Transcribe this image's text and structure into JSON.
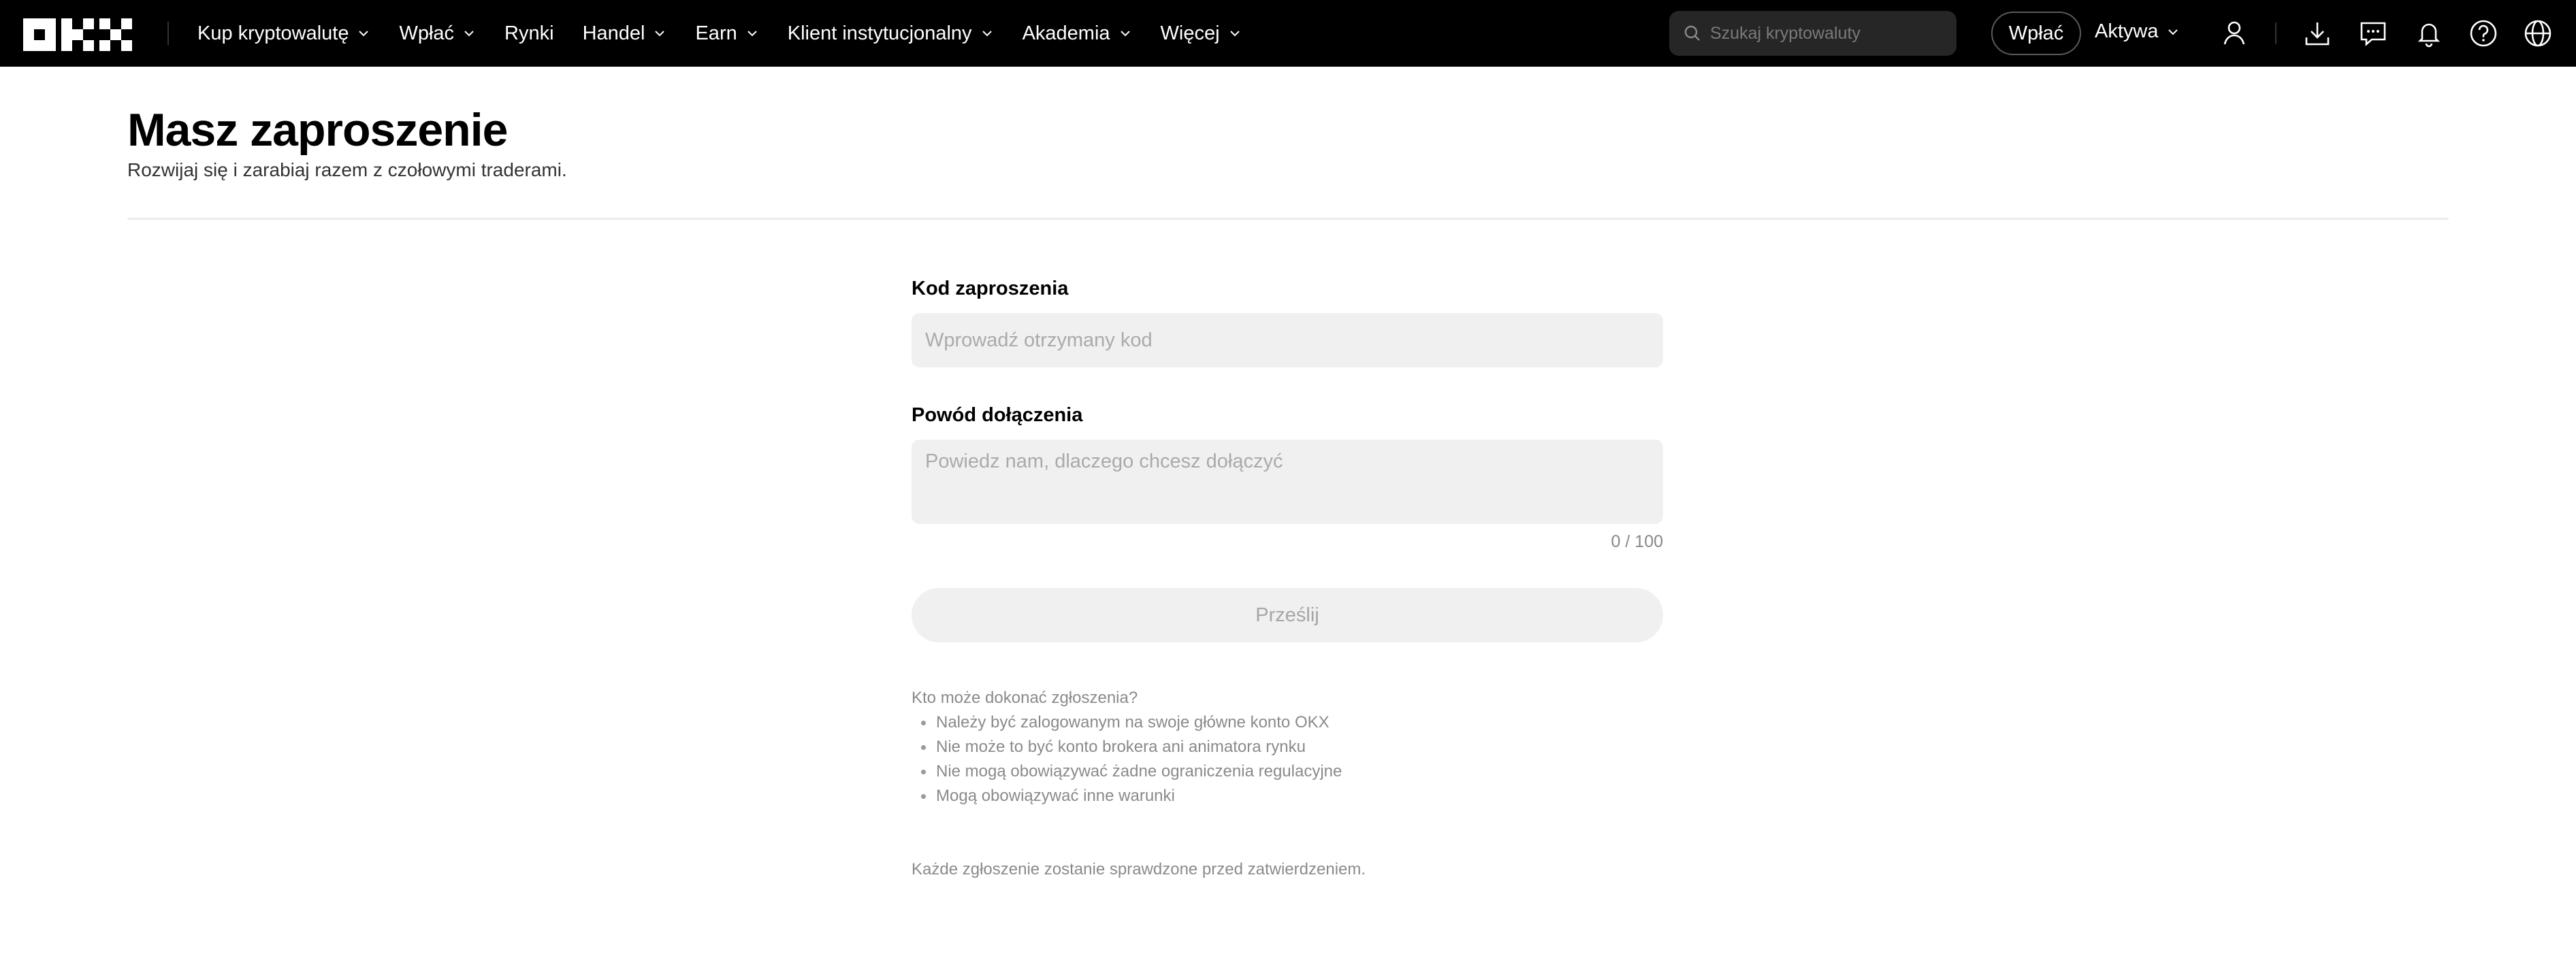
{
  "nav": {
    "logo_text": "OKX",
    "items": [
      {
        "label": "Kup kryptowalutę",
        "dropdown": true
      },
      {
        "label": "Wpłać",
        "dropdown": true
      },
      {
        "label": "Rynki",
        "dropdown": false
      },
      {
        "label": "Handel",
        "dropdown": true
      },
      {
        "label": "Earn",
        "dropdown": true
      },
      {
        "label": "Klient instytucjonalny",
        "dropdown": true
      },
      {
        "label": "Akademia",
        "dropdown": true
      },
      {
        "label": "Więcej",
        "dropdown": true
      }
    ],
    "search_placeholder": "Szukaj kryptowaluty",
    "deposit_button": "Wpłać",
    "assets_label": "Aktywa",
    "icons": [
      "user-icon",
      "download-icon",
      "chat-icon",
      "bell-icon",
      "help-icon",
      "globe-icon"
    ]
  },
  "header": {
    "title": "Masz zaproszenie",
    "subtitle": "Rozwijaj się i zarabiaj razem z czołowymi traderami."
  },
  "form": {
    "code_label": "Kod zaproszenia",
    "code_placeholder": "Wprowadź otrzymany kod",
    "code_value": "",
    "reason_label": "Powód dołączenia",
    "reason_placeholder": "Powiedz nam, dlaczego chcesz dołączyć",
    "reason_value": "",
    "counter": "0 / 100",
    "submit_label": "Prześlij"
  },
  "eligibility": {
    "heading": "Kto może dokonać zgłoszenia?",
    "items": [
      "Należy być zalogowanym na swoje główne konto OKX",
      "Nie może to być konto brokera ani animatora rynku",
      "Nie mogą obowiązywać żadne ograniczenia regulacyjne",
      "Mogą obowiązywać inne warunki"
    ],
    "footer_note": "Każde zgłoszenie zostanie sprawdzone przed zatwierdzeniem."
  },
  "colors": {
    "nav_bg": "#000000",
    "input_bg": "#f0f0f0",
    "muted_text": "#8a8a8a"
  }
}
